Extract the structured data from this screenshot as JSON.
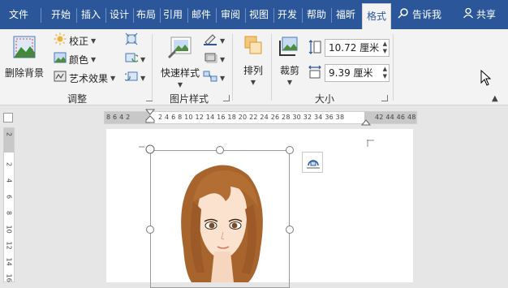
{
  "tabs": [
    {
      "label": "文件",
      "active": false
    },
    {
      "label": "开始",
      "active": false
    },
    {
      "label": "插入",
      "active": false
    },
    {
      "label": "设计",
      "active": false
    },
    {
      "label": "布局",
      "active": false
    },
    {
      "label": "引用",
      "active": false
    },
    {
      "label": "邮件",
      "active": false
    },
    {
      "label": "审阅",
      "active": false
    },
    {
      "label": "视图",
      "active": false
    },
    {
      "label": "开发",
      "active": false
    },
    {
      "label": "帮助",
      "active": false
    },
    {
      "label": "福昕",
      "active": false
    },
    {
      "label": "格式",
      "active": true
    }
  ],
  "tell_me": {
    "label": "告诉我",
    "icon": "lightbulb-search-icon"
  },
  "share": {
    "label": "共享",
    "icon": "person-icon"
  },
  "ribbon": {
    "adjust": {
      "remove_bg": "删除背景",
      "corrections": "校正",
      "color": "颜色",
      "artistic": "艺术效果",
      "label": "调整"
    },
    "styles": {
      "quick_styles": "快速样式",
      "label": "图片样式"
    },
    "arrange": {
      "arrange": "排列"
    },
    "size": {
      "crop": "裁剪",
      "height_value": "10.72 厘米",
      "width_value": "9.39 厘米",
      "label": "大小"
    }
  },
  "ruler": {
    "text": "8  6  4  2  ",
    "text2": "2  4  6  8  10  12  14  16  18  20  22  24  26  28  30  32  34  36  38",
    "text3": "42  44  46  48"
  },
  "vruler": [
    "2",
    "2",
    "4",
    "6",
    "8",
    "10",
    "12",
    "14",
    "16"
  ],
  "colors": {
    "accent": "#2b579a",
    "ribbon_bg": "#f3f3f3",
    "canvas_bg": "#e6e6e6"
  }
}
